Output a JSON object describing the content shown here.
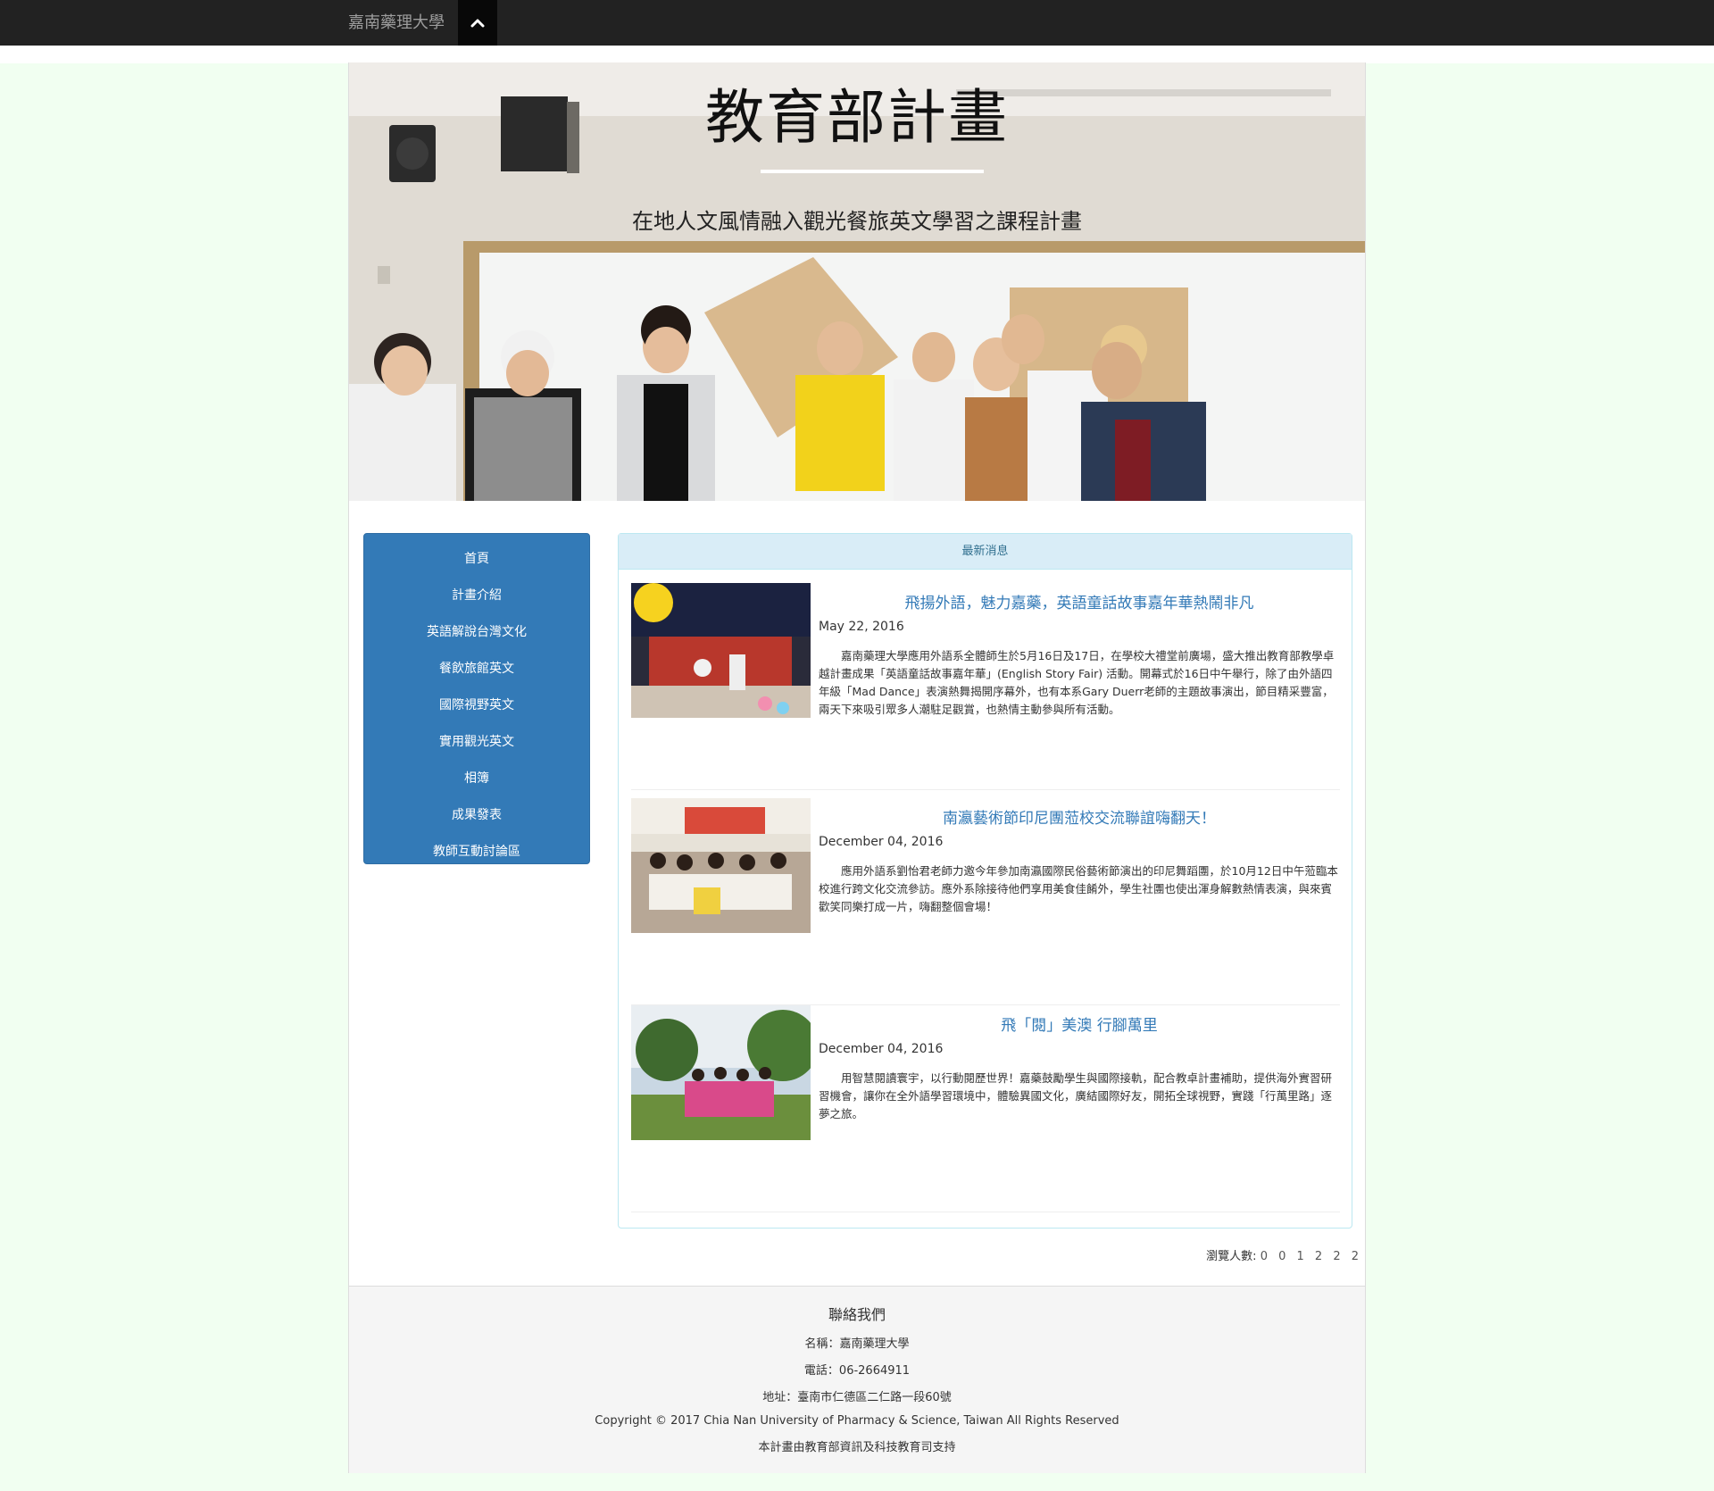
{
  "navbar": {
    "brand": "嘉南藥理大學",
    "toggle_icon": "chevron-up-icon"
  },
  "hero": {
    "title": "教育部計畫",
    "subtitle": "在地人文風情融入觀光餐旅英文學習之課程計畫"
  },
  "sidebar": {
    "items": [
      {
        "label": "首頁"
      },
      {
        "label": "計畫介紹"
      },
      {
        "label": "英語解說台灣文化"
      },
      {
        "label": "餐飲旅館英文"
      },
      {
        "label": "國際視野英文"
      },
      {
        "label": "實用觀光英文"
      },
      {
        "label": "相簿"
      },
      {
        "label": "成果發表"
      },
      {
        "label": "教師互動討論區"
      }
    ]
  },
  "news": {
    "heading": "最新消息",
    "items": [
      {
        "title": "飛揚外語，魅力嘉藥，英語童話故事嘉年華熱鬧非凡",
        "date": "May 22, 2016",
        "body": "嘉南藥理大學應用外語系全體師生於5月16日及17日，在學校大禮堂前廣場，盛大推出教育部教學卓越計畫成果「英語童話故事嘉年華」(English Story Fair) 活動。開幕式於16日中午舉行，除了由外語四年級「Mad Dance」表演熱舞揭開序幕外，也有本系Gary Duerr老師的主題故事演出，節目精采豐富，兩天下來吸引眾多人潮駐足觀賞，也熱情主動參與所有活動。"
      },
      {
        "title": "南瀛藝術節印尼團蒞校交流聯誼嗨翻天！",
        "date": "December 04, 2016",
        "body": "應用外語系劉怡君老師力邀今年參加南瀛國際民俗藝術節演出的印尼舞蹈團，於10月12日中午蒞臨本校進行跨文化交流參訪。應外系除接待他們享用美食佳餚外，學生社團也使出渾身解數熱情表演，與來賓歡笑同樂打成一片，嗨翻整個會場！"
      },
      {
        "title": "飛「閱」美澳 行腳萬里",
        "date": "December 04, 2016",
        "body": "用智慧閱讀寰宇，以行動閱歷世界！嘉藥鼓勵學生與國際接軌，配合教卓計畫補助，提供海外實習研習機會，讓你在全外語學習環境中，體驗異國文化，廣結國際好友，開拓全球視野，實踐「行萬里路」逐夢之旅。"
      }
    ]
  },
  "counter": {
    "label": "瀏覽人數:",
    "digits": "0 0 1 2 2 2"
  },
  "footer": {
    "heading": "聯絡我們",
    "name": "名稱：嘉南藥理大學",
    "phone": "電話：06-2664911",
    "address": "地址：臺南市仁德區二仁路一段60號",
    "copyright": "Copyright © 2017 Chia Nan University of Pharmacy & Science, Taiwan All Rights Reserved",
    "support": "本計畫由教育部資訊及科技教育司支持"
  }
}
